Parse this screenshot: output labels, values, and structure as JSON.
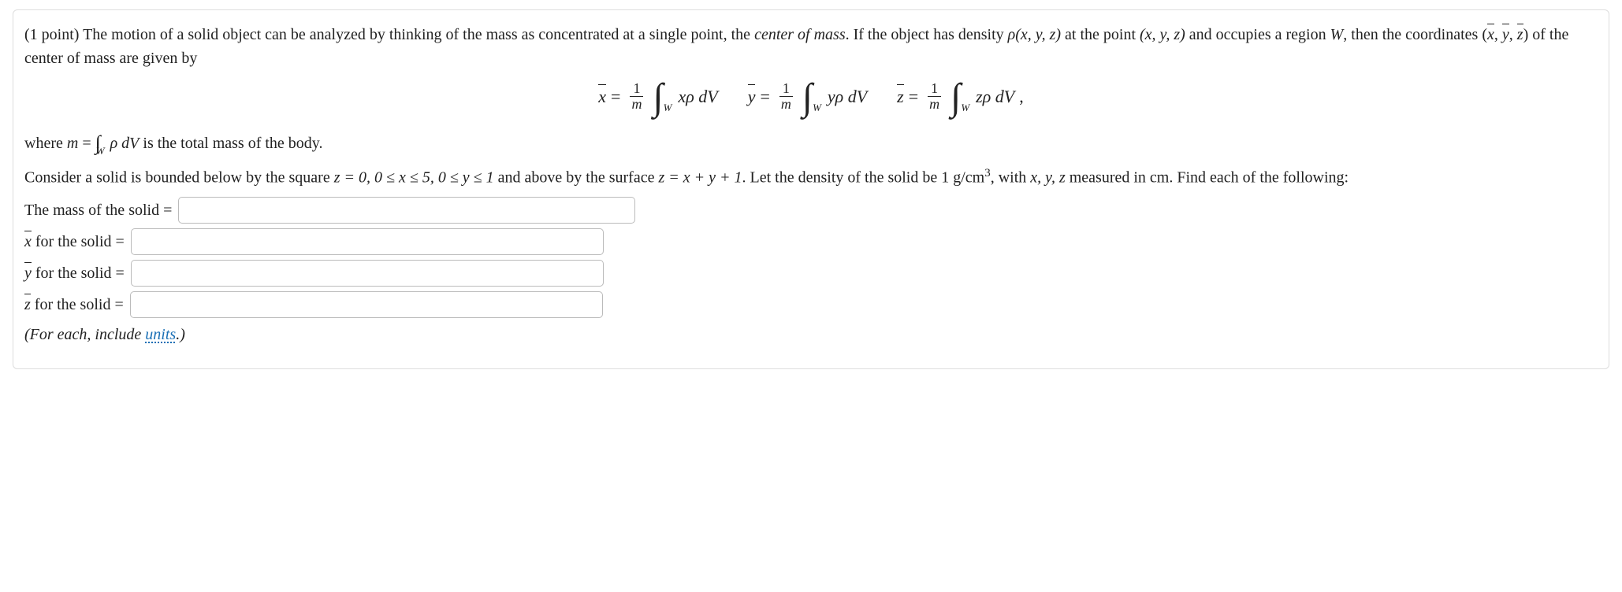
{
  "points": "(1 point)",
  "intro_a": "The motion of a solid object can be analyzed by thinking of the mass as concentrated at a single point, the ",
  "intro_com": "center of mass",
  "intro_b": ". If the object has density ",
  "rho": "ρ(x, y, z)",
  "intro_c": " at the point ",
  "pt": "(x, y, z)",
  "intro_d": " and occupies a region ",
  "Wvar": "W",
  "intro_e": ", then the coordinates ",
  "intro_f": " of the center of mass are given by",
  "bar_x": "x",
  "bar_y": "y",
  "bar_z": "z",
  "frac_num": "1",
  "frac_den": "m",
  "intW": "W",
  "xp": "xρ dV",
  "yp": "yρ dV",
  "zp": "zρ dV",
  "eq": "=",
  "comma": ",",
  "where_a": "where ",
  "mvar": "m",
  "where_b": " is the total mass of the body.",
  "rhodv": "ρ dV",
  "para2_a": "Consider a solid is bounded below by the square ",
  "bounds": "z = 0, 0 ≤ x ≤ 5, 0 ≤ y ≤ 1",
  "para2_b": " and above by the surface ",
  "surface": "z = x + y + 1",
  "para2_c": ". Let the density of the solid be 1 g/cm",
  "sup3": "3",
  "para2_d": ", with ",
  "xyz": "x, y, z",
  "para2_e": " measured in cm. Find each of the following:",
  "q_mass": "The mass of the solid =",
  "q_x": " for the solid =",
  "q_y": " for the solid =",
  "q_z": " for the solid =",
  "hint_a": "(For each, include ",
  "units_word": "units",
  "hint_b": ".)"
}
